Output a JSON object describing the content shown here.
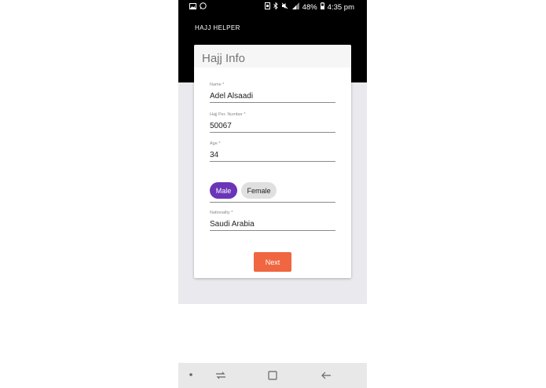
{
  "status_bar": {
    "left_icons": [
      "image-icon",
      "whatsapp-icon"
    ],
    "right_icons": [
      "nfc-icon",
      "bluetooth-icon",
      "mute-icon",
      "signal-icon"
    ],
    "battery": "48%",
    "time": "4:35 pm"
  },
  "app_bar": {
    "title": "HAJJ HELPER"
  },
  "card": {
    "title": "Hajj Info"
  },
  "form": {
    "name": {
      "label": "Name *",
      "value": "Adel Alsaadi"
    },
    "hajj_permit": {
      "label": "Hajj Per. Number *",
      "value": "50067"
    },
    "age": {
      "label": "Age *",
      "value": "34"
    },
    "gender": {
      "options": [
        "Male",
        "Female"
      ],
      "selected": "Male"
    },
    "nationality": {
      "label": "Nationality *",
      "value": "Saudi Arabia"
    }
  },
  "next_button": {
    "label": "Next"
  },
  "colors": {
    "accent": "#6a35b7",
    "button": "#ef6641",
    "header": "#000000",
    "background": "#e9e9ee"
  },
  "nav_bar": {
    "items": [
      "dot-icon",
      "recent-apps-icon",
      "home-icon",
      "back-icon"
    ]
  }
}
